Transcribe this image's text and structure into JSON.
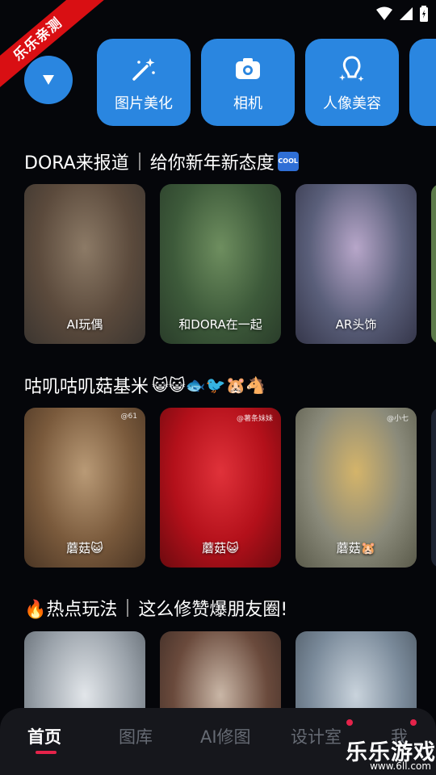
{
  "ribbon": {
    "text": "乐乐亲测"
  },
  "tools": [
    {
      "label": "图片美化",
      "icon": "magic-wand-icon"
    },
    {
      "label": "相机",
      "icon": "camera-icon"
    },
    {
      "label": "人像美容",
      "icon": "portrait-icon"
    }
  ],
  "sections": [
    {
      "title": "DORA来报道",
      "title_suffix": "给你新年新态度",
      "badge": "COOL",
      "cards": [
        {
          "label": "AI玩偶",
          "colors": [
            "#5b4a3c",
            "#8c7a66",
            "#3b3530"
          ]
        },
        {
          "label": "和DORA在一起",
          "colors": [
            "#3d5a3a",
            "#6e8e5f",
            "#2a3d2a"
          ]
        },
        {
          "label": "AR头饰",
          "colors": [
            "#5a5f7a",
            "#b7a6c9",
            "#35364a"
          ]
        }
      ]
    },
    {
      "title": "咕叽咕叽菇基米",
      "emojis": "😺😺🐟🐦🐹🐴",
      "cards": [
        {
          "label": "蘑菇😺",
          "credit": "@61",
          "colors": [
            "#7a5a3c",
            "#b99a76",
            "#4a3524"
          ]
        },
        {
          "label": "蘑菇😺",
          "credit": "@薯条妹妹",
          "colors": [
            "#b3101a",
            "#e0323a",
            "#6d0a0f"
          ]
        },
        {
          "label": "蘑菇🐹",
          "credit": "@小七",
          "colors": [
            "#8a8a7a",
            "#d4b46a",
            "#5a5a4a"
          ]
        }
      ]
    },
    {
      "title": "🔥热点玩法",
      "title_suffix": "这么修赞爆朋友圈!",
      "cards": [
        {
          "label": "",
          "colors": [
            "#9aa2aa",
            "#e2e6ea",
            "#5a626a"
          ]
        },
        {
          "label": "",
          "colors": [
            "#6a4a3c",
            "#c9b6a6",
            "#3a2a24"
          ]
        },
        {
          "label": "",
          "colors": [
            "#7a8a9a",
            "#c9d3dc",
            "#4a5560"
          ]
        }
      ]
    }
  ],
  "nav": [
    {
      "label": "首页",
      "active": true
    },
    {
      "label": "图库"
    },
    {
      "label": "AI修图"
    },
    {
      "label": "设计室"
    },
    {
      "label": "我"
    }
  ],
  "watermark": {
    "title": "乐乐游戏",
    "url": "www.6ll.com"
  }
}
